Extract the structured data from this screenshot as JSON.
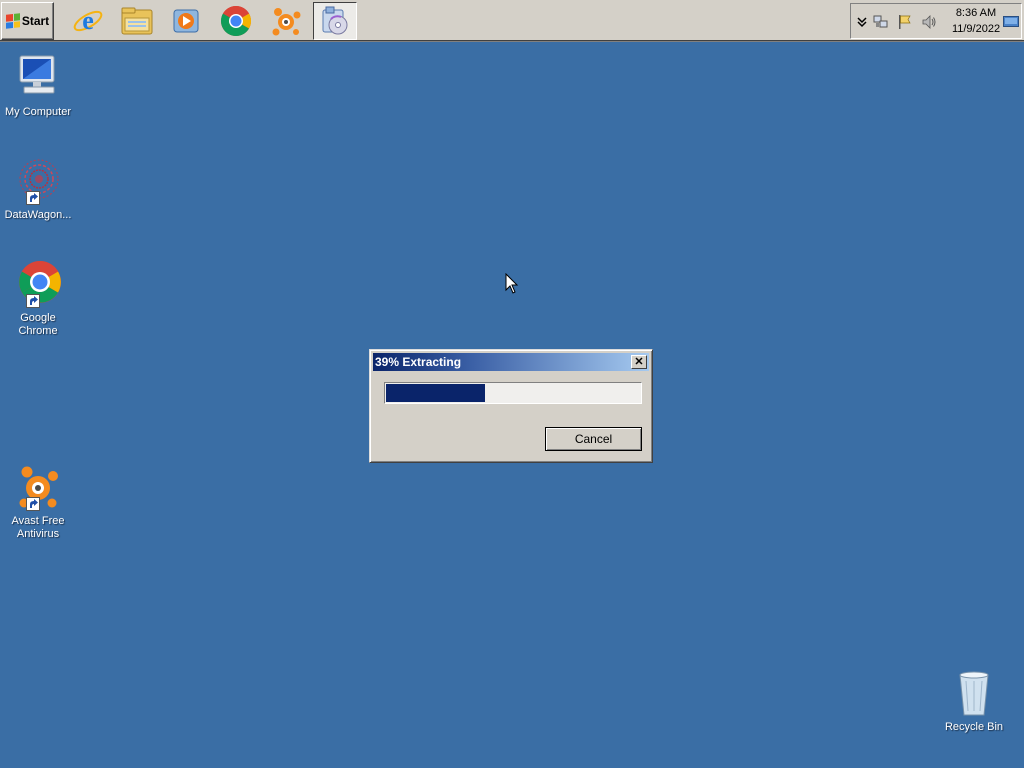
{
  "taskbar": {
    "start_label": "Start",
    "quick_launch": [
      {
        "icon": "internet-explorer-icon"
      },
      {
        "icon": "windows-explorer-icon"
      },
      {
        "icon": "media-player-icon"
      },
      {
        "icon": "chrome-icon"
      },
      {
        "icon": "avast-icon"
      },
      {
        "icon": "winrar-extract-icon",
        "active": true
      }
    ],
    "tray": {
      "icons": [
        "show-hidden-icons-chevron-icon",
        "network-icon",
        "action-center-flag-icon",
        "volume-icon",
        "show-desktop-icon"
      ],
      "time": "8:36 AM",
      "date": "11/9/2022"
    }
  },
  "desktop": {
    "background_color": "#3a6ea5",
    "icons": [
      {
        "label": "My Computer",
        "icon": "my-computer-icon"
      },
      {
        "label": "DataWagon...",
        "icon": "datawagon-icon"
      },
      {
        "label": "Google Chrome",
        "icon": "chrome-icon"
      },
      {
        "label": "Avast Free Antivirus",
        "icon": "avast-icon"
      },
      {
        "label": "Recycle Bin",
        "icon": "recycle-bin-icon"
      }
    ]
  },
  "dialog": {
    "title": "39% Extracting",
    "progress_percent": 39,
    "cancel_label": "Cancel",
    "progress_color": "#0a246a"
  }
}
